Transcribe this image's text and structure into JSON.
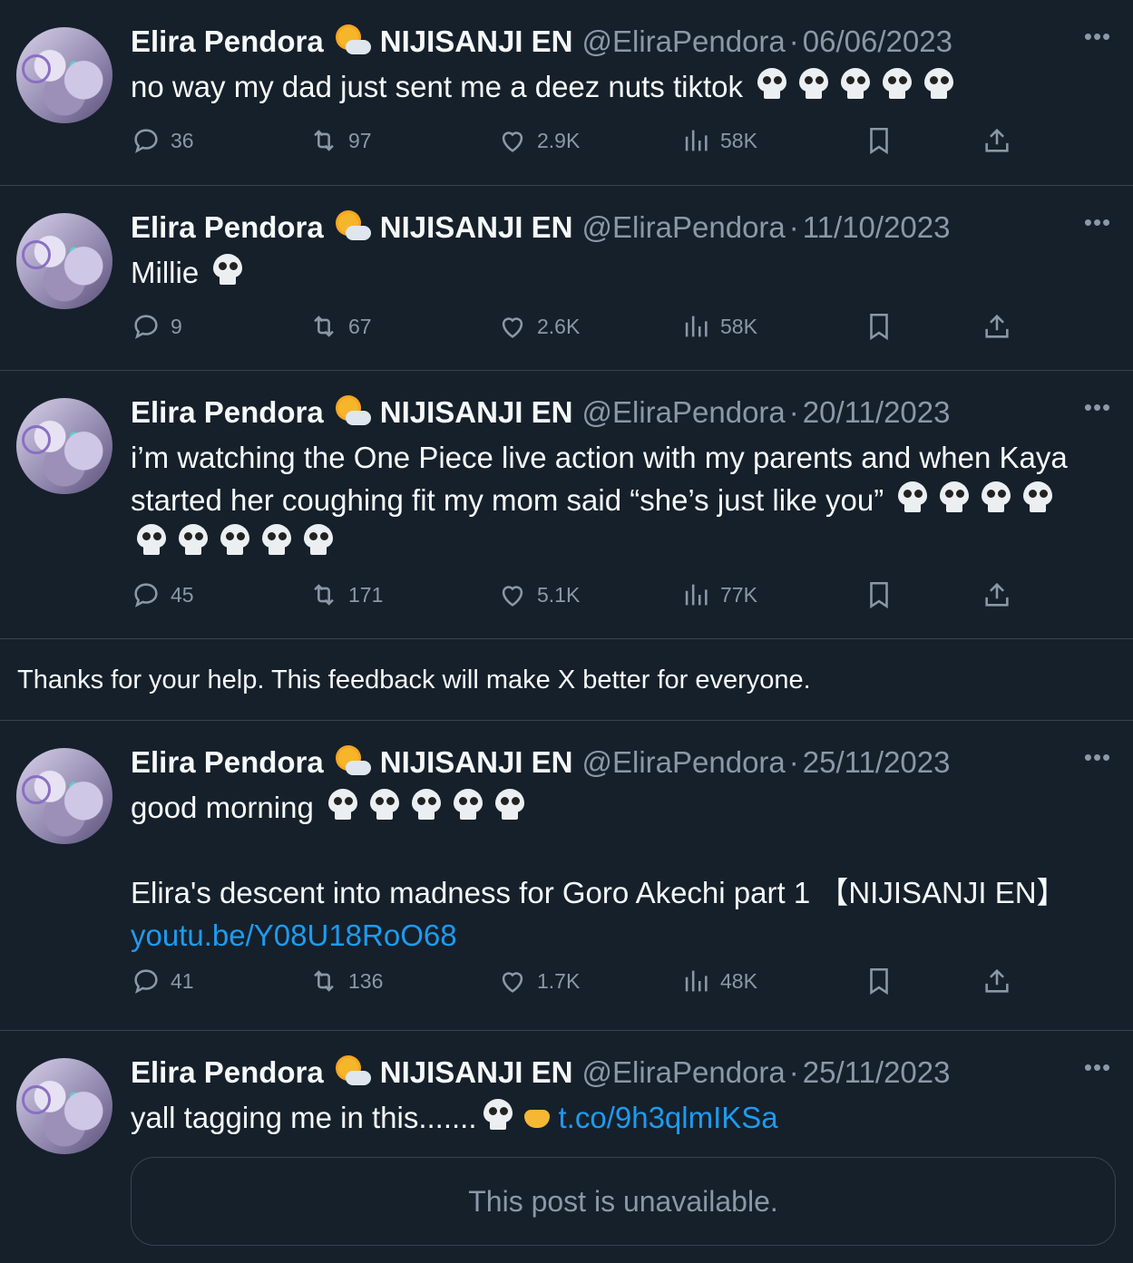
{
  "tweets": [
    {
      "name": "Elira Pendora",
      "org": "NIJISANJI EN",
      "handle": "@EliraPendora",
      "sep": "·",
      "date": "06/06/2023",
      "lines": [
        [
          "no way my dad just sent me a deez nuts tiktok "
        ]
      ],
      "skull_counts": [
        5
      ],
      "replies": "36",
      "reposts": "97",
      "likes": "2.9K",
      "views": "58K"
    },
    {
      "name": "Elira Pendora",
      "org": "NIJISANJI EN",
      "handle": "@EliraPendora",
      "sep": "·",
      "date": "11/10/2023",
      "text": "Millie ",
      "replies": "9",
      "reposts": "67",
      "likes": "2.6K",
      "views": "58K"
    },
    {
      "name": "Elira Pendora",
      "org": "NIJISANJI EN",
      "handle": "@EliraPendora",
      "sep": "·",
      "date": "20/11/2023",
      "line1": "i’m watching the One Piece live action with my parents and when Kaya",
      "line2": "started her coughing fit my mom said “she’s just like you” ",
      "replies": "45",
      "reposts": "171",
      "likes": "5.1K",
      "views": "77K"
    },
    {
      "name": "Elira Pendora",
      "org": "NIJISANJI EN",
      "handle": "@EliraPendora",
      "sep": "·",
      "date": "25/11/2023",
      "line1": "good morning ",
      "line2": "Elira's descent into madness for Goro Akechi part 1 【NIJISANJI EN】",
      "link": "youtu.be/Y08U18RoO68",
      "replies": "41",
      "reposts": "136",
      "likes": "1.7K",
      "views": "48K"
    },
    {
      "name": "Elira Pendora",
      "org": "NIJISANJI EN",
      "handle": "@EliraPendora",
      "sep": "·",
      "date": "25/11/2023",
      "text": "yall tagging me in this.......",
      "link": "t.co/9h3qlmIKSa",
      "quote": "This post is unavailable."
    }
  ],
  "notice": "Thanks for your help. This feedback will make X better for everyone.",
  "icons": {
    "reply": "reply-icon",
    "repost": "repost-icon",
    "like": "heart-icon",
    "views": "views-icon",
    "bookmark": "bookmark-icon",
    "share": "share-icon",
    "more": "more-icon",
    "badge": "sun-cloud-icon",
    "emoji": "skull-icon"
  },
  "colors": {
    "background": "#15202b",
    "text": "#f7f9f9",
    "muted": "#8b98a5",
    "link": "#1d9bf0",
    "divider": "#38444d"
  }
}
